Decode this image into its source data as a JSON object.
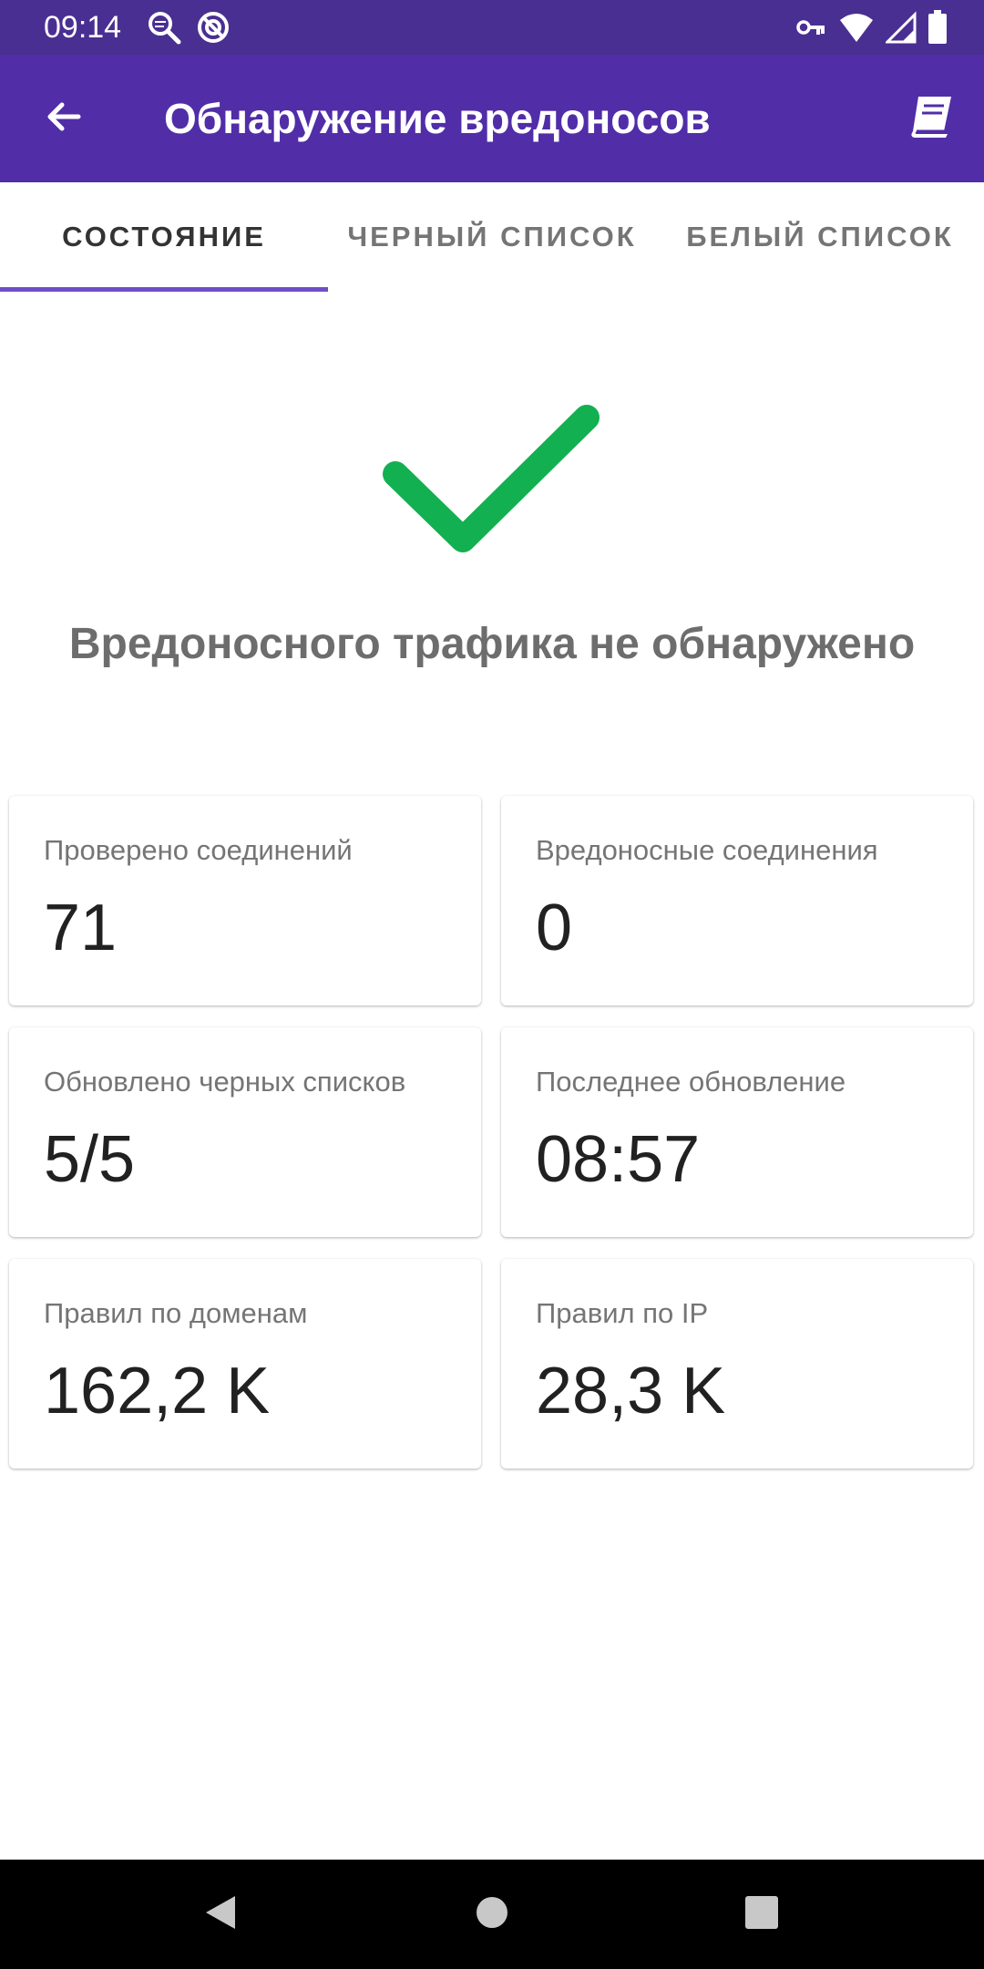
{
  "status_bar": {
    "time": "09:14",
    "icons_left": [
      "search-status-icon",
      "circle-status-icon"
    ],
    "icons_right": [
      "vpn-key-icon",
      "wifi-icon",
      "signal-icon",
      "battery-icon"
    ]
  },
  "app_bar": {
    "title": "Обнаружение вредоносов",
    "back_icon": "arrow-left-icon",
    "action_icon": "book-icon",
    "color": "#512da8",
    "status_color": "#4a2f92"
  },
  "tabs": [
    {
      "label": "СОСТОЯНИЕ",
      "active": true
    },
    {
      "label": "ЧЕРНЫЙ СПИСОК",
      "active": false
    },
    {
      "label": "БЕЛЫЙ СПИСОК",
      "active": false
    }
  ],
  "status": {
    "icon": "checkmark-icon",
    "icon_color": "#12b050",
    "message": "Вредоносного трафика не обнаружено"
  },
  "cards": [
    {
      "label": "Проверено соединений",
      "value": "71"
    },
    {
      "label": "Вредоносные соединения",
      "value": "0"
    },
    {
      "label": "Обновлено черных списков",
      "value": "5/5"
    },
    {
      "label": "Последнее обновление",
      "value": "08:57"
    },
    {
      "label": "Правил по доменам",
      "value": "162,2 K"
    },
    {
      "label": "Правил по IP",
      "value": "28,3 K"
    }
  ],
  "nav_bar": {
    "icons": [
      "back-triangle-icon",
      "home-circle-icon",
      "recents-square-icon"
    ]
  }
}
